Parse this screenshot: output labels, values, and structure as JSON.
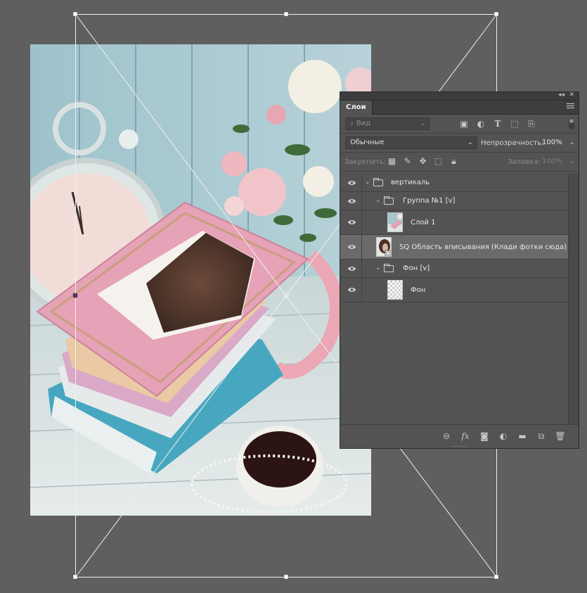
{
  "panel": {
    "tab_label": "Слои",
    "collapse_glyph": "◂◂",
    "close_glyph": "✕"
  },
  "filter": {
    "placeholder": "Вид",
    "icons": [
      "image-filter-icon",
      "adjustment-filter-icon",
      "type-filter-icon",
      "shape-filter-icon",
      "smart-object-filter-icon"
    ]
  },
  "blend": {
    "mode": "Обычные",
    "opacity_label": "Непрозрачность:",
    "opacity_value": "100%"
  },
  "lock": {
    "label": "Закрепить:",
    "fill_label": "Заливка:",
    "fill_value": "100%",
    "icons": [
      "lock-transparent-pixels-icon",
      "lock-image-pixels-icon",
      "lock-position-icon",
      "lock-artboard-icon",
      "lock-all-icon"
    ]
  },
  "layers": [
    {
      "name": "вертикаль",
      "type": "group",
      "level": 0,
      "expanded": true
    },
    {
      "name": "Группа №1 [v]",
      "type": "group",
      "level": 1,
      "expanded": true
    },
    {
      "name": "Слой 1",
      "type": "layer",
      "level": 2,
      "thumb": "photo"
    },
    {
      "name": "SQ Область вписывания (Клади фотки сюда) ...",
      "type": "smart",
      "level": 1,
      "thumb": "portrait",
      "selected": true
    },
    {
      "name": "Фон [v]",
      "type": "group",
      "level": 1,
      "expanded": true
    },
    {
      "name": "Фон",
      "type": "layer",
      "level": 2,
      "thumb": "transparent"
    }
  ],
  "bottom_icons": [
    "link-layers-icon",
    "fx-icon",
    "layer-mask-icon",
    "adjustment-layer-icon",
    "new-group-icon",
    "new-layer-icon",
    "delete-layer-icon"
  ],
  "colors": {
    "workspace": "#5f5f5f",
    "panel": "#535353",
    "selected_row": "#6a6a6a"
  }
}
